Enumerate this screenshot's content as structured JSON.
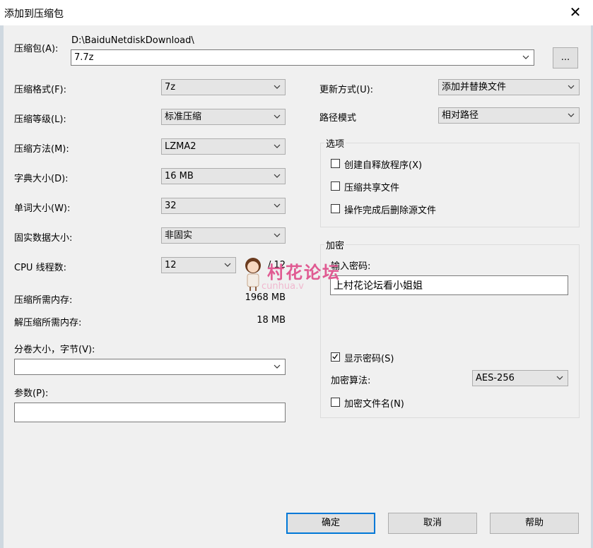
{
  "window": {
    "title": "添加到压缩包"
  },
  "archive": {
    "label": "压缩包(A):",
    "path": "D:\\BaiduNetdiskDownload\\",
    "name": "7.7z",
    "browse_label": "..."
  },
  "left": {
    "format": {
      "label": "压缩格式(F):",
      "value": "7z"
    },
    "level": {
      "label": "压缩等级(L):",
      "value": "标准压缩"
    },
    "method": {
      "label": "压缩方法(M):",
      "value": "LZMA2"
    },
    "dict": {
      "label": "字典大小(D):",
      "value": "16 MB"
    },
    "word": {
      "label": "单词大小(W):",
      "value": "32"
    },
    "solid": {
      "label": "固实数据大小:",
      "value": "非固实"
    },
    "cpu": {
      "label": "CPU 线程数:",
      "value": "12",
      "total": "/ 12"
    },
    "mem_compress": {
      "label": "压缩所需内存:",
      "value": "1968 MB"
    },
    "mem_decompress": {
      "label": "解压缩所需内存:",
      "value": "18 MB"
    },
    "split": {
      "label": "分卷大小，字节(V):",
      "value": ""
    },
    "params": {
      "label": "参数(P):",
      "value": ""
    }
  },
  "right": {
    "update": {
      "label": "更新方式(U):",
      "value": "添加并替换文件"
    },
    "pathmode": {
      "label": "路径模式",
      "value": "相对路径"
    },
    "options": {
      "title": "选项",
      "sfx": "创建自释放程序(X)",
      "shared": "压缩共享文件",
      "delete": "操作完成后删除源文件"
    },
    "encryption": {
      "title": "加密",
      "password_label": "输入密码:",
      "password_value": "上村花论坛看小姐姐",
      "show_password": "显示密码(S)",
      "method_label": "加密算法:",
      "method_value": "AES-256",
      "encrypt_names": "加密文件名(N)"
    }
  },
  "buttons": {
    "ok": "确定",
    "cancel": "取消",
    "help": "帮助"
  },
  "watermark": {
    "text": "村花论坛",
    "sub": "cunhua.v"
  }
}
